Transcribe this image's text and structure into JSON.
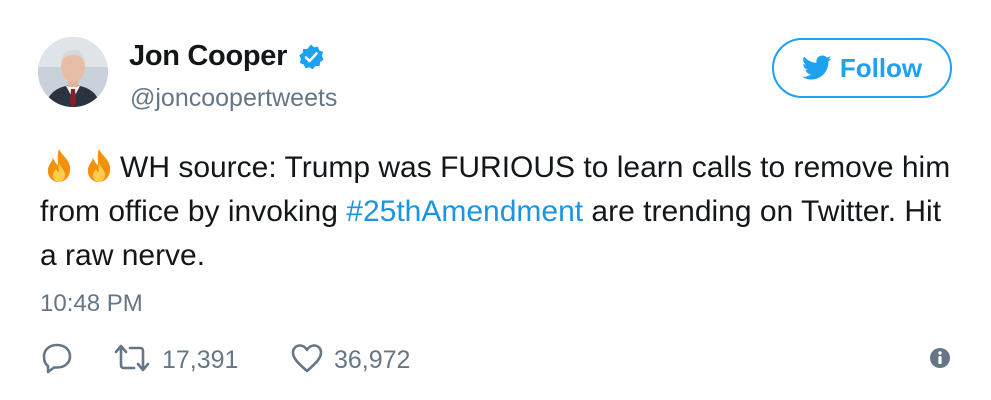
{
  "user": {
    "display_name": "Jon Cooper",
    "handle": "@joncoopertweets",
    "verified": true
  },
  "follow_button": {
    "label": "Follow"
  },
  "tweet": {
    "icons": [
      "fire-emoji",
      "fire-emoji"
    ],
    "text_before_hashtag": "WH source: Trump was FURIOUS to learn calls to remove him from office by invoking ",
    "hashtag": "#25thAmendment",
    "text_after_hashtag": " are trending on Twitter. Hit a raw nerve.",
    "timestamp": "10:48 PM"
  },
  "actions": {
    "reply_icon": "reply-icon",
    "retweet_icon": "retweet-icon",
    "retweet_count": "17,391",
    "like_icon": "heart-icon",
    "like_count": "36,972",
    "info_icon": "info-icon"
  },
  "colors": {
    "accent": "#1da1f2",
    "hashtag": "#1b95e0",
    "secondary_text": "#657786",
    "primary_text": "#14171a"
  }
}
